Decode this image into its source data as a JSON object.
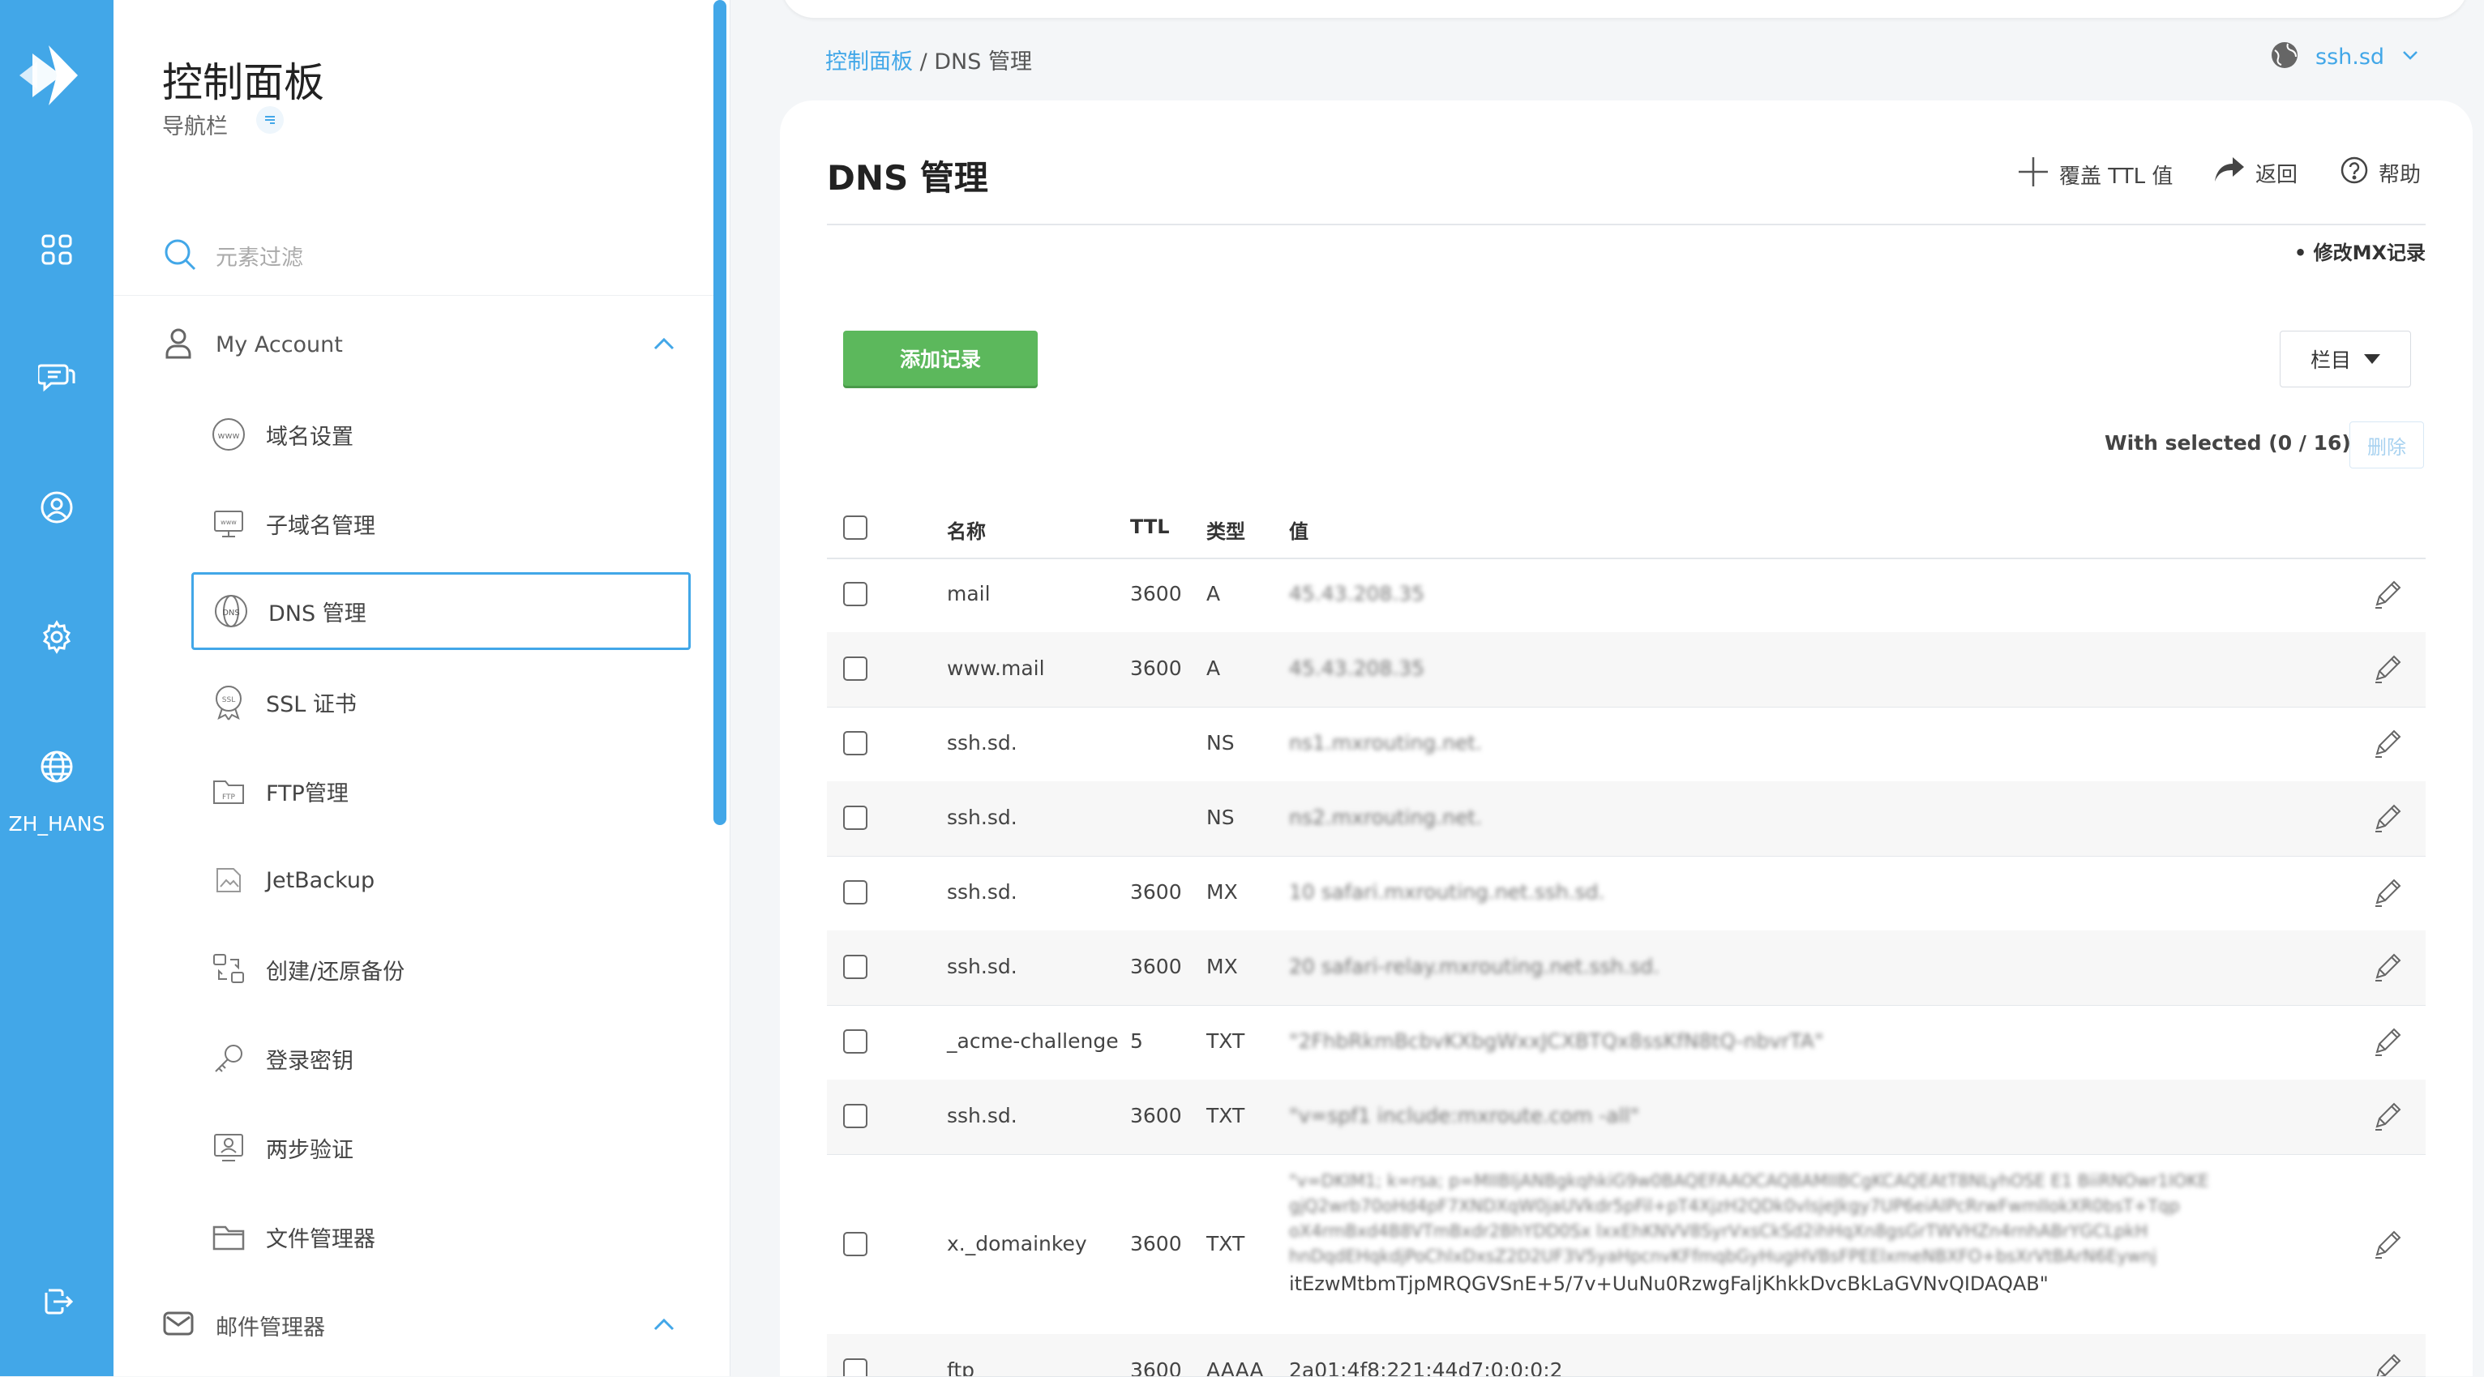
{
  "rail": {
    "lang_label": "ZH_HANS"
  },
  "nav": {
    "title": "控制面板",
    "subtitle": "导航栏",
    "filter_placeholder": "元素过滤",
    "account_section": "My Account",
    "items": [
      {
        "label": "域名设置",
        "icon": "www-globe-icon"
      },
      {
        "label": "子域名管理",
        "icon": "subdomain-monitor-icon"
      },
      {
        "label": "DNS 管理",
        "icon": "dns-globe-icon",
        "active": true
      },
      {
        "label": "SSL 证书",
        "icon": "ssl-badge-icon"
      },
      {
        "label": "FTP管理",
        "icon": "ftp-folder-icon"
      },
      {
        "label": "JetBackup",
        "icon": "broken-image-icon"
      },
      {
        "label": "创建/还原备份",
        "icon": "backup-restore-icon"
      },
      {
        "label": "登录密钥",
        "icon": "key-icon"
      },
      {
        "label": "两步验证",
        "icon": "two-factor-icon"
      },
      {
        "label": "文件管理器",
        "icon": "folder-icon"
      }
    ],
    "mail_section": "邮件管理器"
  },
  "header": {
    "breadcrumb_link": "控制面板",
    "breadcrumb_sep": " / ",
    "breadcrumb_current": "DNS 管理",
    "domain": "ssh.sd"
  },
  "main": {
    "title": "DNS 管理",
    "override_ttl": "覆盖 TTL 值",
    "back": "返回",
    "help": "帮助",
    "mx_note": "• 修改MX记录",
    "add_record": "添加记录",
    "columns": "栏目",
    "with_selected": "With selected (0 / 16):",
    "delete": "删除"
  },
  "table": {
    "headers": {
      "name": "名称",
      "ttl": "TTL",
      "type": "类型",
      "value": "值"
    },
    "rows": [
      {
        "name": "mail",
        "ttl": "3600",
        "type": "A",
        "value": "45.43.208.35"
      },
      {
        "name": "www.mail",
        "ttl": "3600",
        "type": "A",
        "value": "45.43.208.35"
      },
      {
        "name": "ssh.sd.",
        "ttl": "",
        "type": "NS",
        "value": "ns1.mxrouting.net."
      },
      {
        "name": "ssh.sd.",
        "ttl": "",
        "type": "NS",
        "value": "ns2.mxrouting.net."
      },
      {
        "name": "ssh.sd.",
        "ttl": "3600",
        "type": "MX",
        "value": "10 safari.mxrouting.net.ssh.sd."
      },
      {
        "name": "ssh.sd.",
        "ttl": "3600",
        "type": "MX",
        "value": "20 safari-relay.mxrouting.net.ssh.sd."
      },
      {
        "name": "_acme-challenge",
        "ttl": "5",
        "type": "TXT",
        "value": "\"2FhbRkmBcbvKXbgWxxJCXBTQx8ssKfN8tQ-nbvrTA\""
      },
      {
        "name": "ssh.sd.",
        "ttl": "3600",
        "type": "TXT",
        "value": "\"v=spf1 include:mxroute.com -all\""
      },
      {
        "name": "x._domainkey",
        "ttl": "3600",
        "type": "TXT",
        "value_lines": [
          "\"v=DKIM1; k=rsa; p=MIIBIjANBgkqhkiG9w0BAQEFAAOCAQ8AMIIBCgKCAQEAtT8NLyhOSE E1 BiiRNOwr1IOKE",
          "gjQ2wrb70oHd4pF7XNDXqW0jaUVkdr5pFil+pT4XjzH2QDk0vlsjeJkgy7UP6eiAIPcRrwFwmIIokXR0bsT+Tqp",
          "oX4rmBxd4B8VTmBxdr2BhYDD0Sx lxxEhKNVV8SyrVxsCkSd2ihHqXn8gsGrTWVHZn4rnhABrYGCLpkH",
          "hnDqdEHqkdjPoChlxDxsZ2D2UF3V5yaHpcnvKFfmqbGyHugHVBsFPEElxmeNBXFO+bsXrVtBArN6Eywnj"
        ],
        "value_last": "itEzwMtbmTjpMRQGVSnE+5/7v+UuNu0RzwgFaljKhkkDvcBkLaGVNvQIDAQAB\""
      },
      {
        "name": "ftp",
        "ttl": "3600",
        "type": "AAAA",
        "value": "2a01:4f8:221:44d7:0:0:0:2"
      }
    ]
  },
  "colors": {
    "accent": "#42a7e8",
    "add_button": "#5cb85c"
  }
}
